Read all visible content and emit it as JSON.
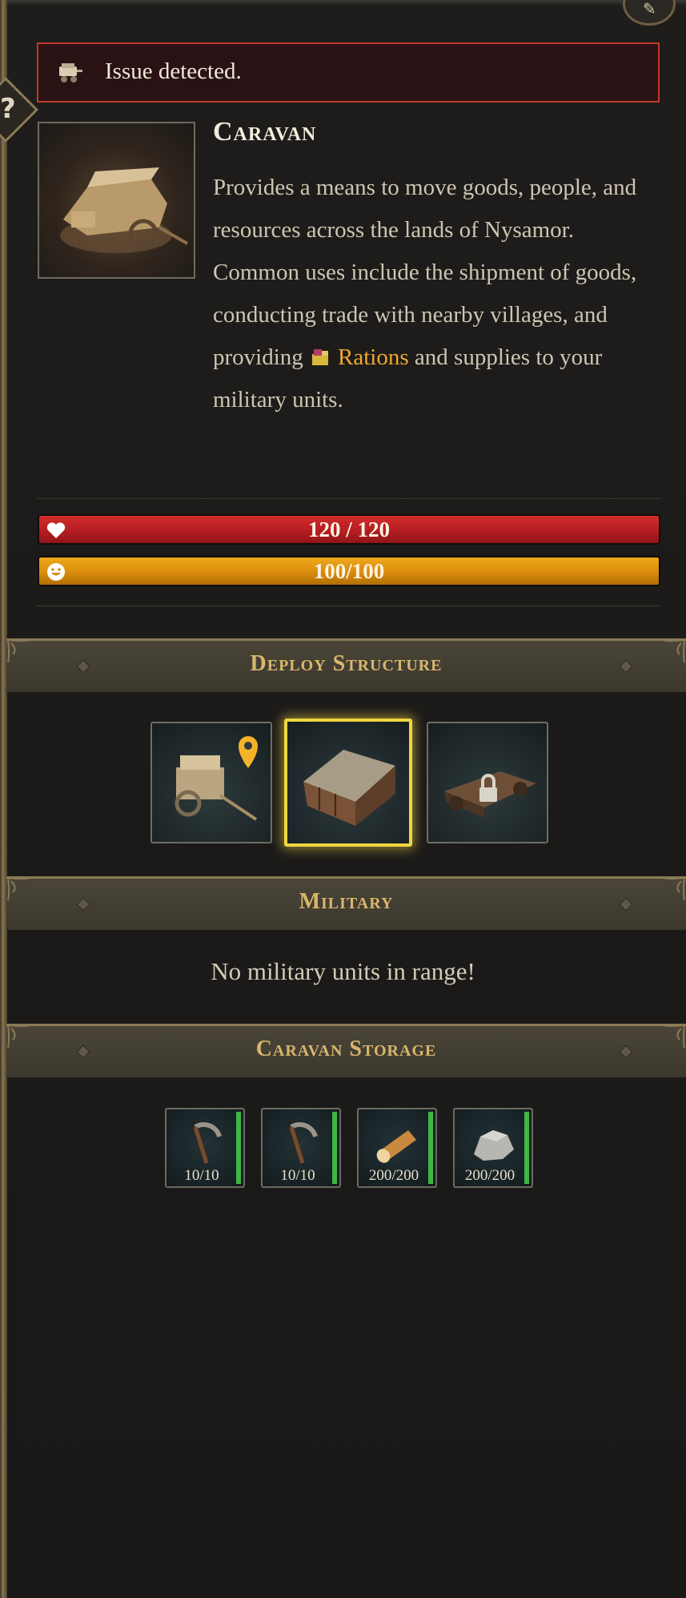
{
  "issue": {
    "text": "Issue detected."
  },
  "building": {
    "name": "Caravan",
    "description_pre": "Provides a means to move goods, people, and resources across the lands of Nysamor. Common uses include the shipment of goods, conducting trade with nearby villages, and providing ",
    "description_highlight": "Rations",
    "description_post": " and supplies to your military units."
  },
  "stats": {
    "health": {
      "text": "120 / 120",
      "current": 120,
      "max": 120,
      "color": "#c0232a"
    },
    "morale": {
      "text": "100/100",
      "current": 100,
      "max": 100,
      "color": "#e09a12"
    }
  },
  "sections": {
    "deploy": "Deploy Structure",
    "military": "Military",
    "storage": "Caravan Storage"
  },
  "deploy_options": [
    {
      "name": "caravan-move",
      "icon": "caravan-with-pin-icon",
      "selected": false,
      "locked": false
    },
    {
      "name": "deploy-structure",
      "icon": "wooden-hall-icon",
      "selected": true,
      "locked": false
    },
    {
      "name": "locked-option",
      "icon": "locked-siege-icon",
      "selected": false,
      "locked": true
    }
  ],
  "military": {
    "empty_text": "No military units in range!"
  },
  "storage": [
    {
      "icon": "sickle-icon",
      "qty": "10/10",
      "fill": 1.0
    },
    {
      "icon": "sickle-icon",
      "qty": "10/10",
      "fill": 1.0
    },
    {
      "icon": "log-icon",
      "qty": "200/200",
      "fill": 1.0
    },
    {
      "icon": "stone-icon",
      "qty": "200/200",
      "fill": 1.0
    }
  ],
  "colors": {
    "accent_gold": "#d9b66c",
    "highlight": "#f0a830",
    "selected_border": "#f0d542",
    "fill_green": "#3cb843"
  }
}
